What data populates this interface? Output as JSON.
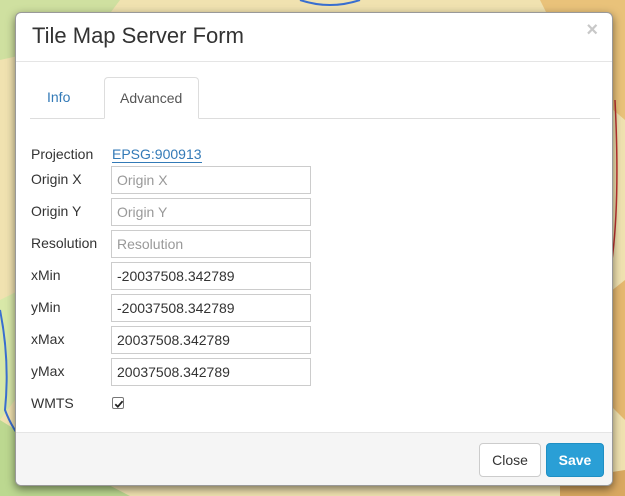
{
  "modal": {
    "title": "Tile Map Server Form",
    "close_glyph": "×"
  },
  "tabs": [
    {
      "label": "Info",
      "active": false
    },
    {
      "label": "Advanced",
      "active": true
    }
  ],
  "fields": {
    "projection": {
      "label": "Projection",
      "value": "EPSG:900913"
    },
    "origin_x": {
      "label": "Origin X",
      "value": "",
      "placeholder": "Origin X"
    },
    "origin_y": {
      "label": "Origin Y",
      "value": "",
      "placeholder": "Origin Y"
    },
    "resolution": {
      "label": "Resolution",
      "value": "",
      "placeholder": "Resolution"
    },
    "xmin": {
      "label": "xMin",
      "value": "-20037508.342789"
    },
    "ymin": {
      "label": "yMin",
      "value": "-20037508.342789"
    },
    "xmax": {
      "label": "xMax",
      "value": "20037508.342789"
    },
    "ymax": {
      "label": "yMax",
      "value": "20037508.342789"
    },
    "wmts": {
      "label": "WMTS",
      "checked": true
    }
  },
  "footer": {
    "close_label": "Close",
    "save_label": "Save"
  },
  "colors": {
    "accent": "#337ab7",
    "save": "#2a9fd6"
  }
}
